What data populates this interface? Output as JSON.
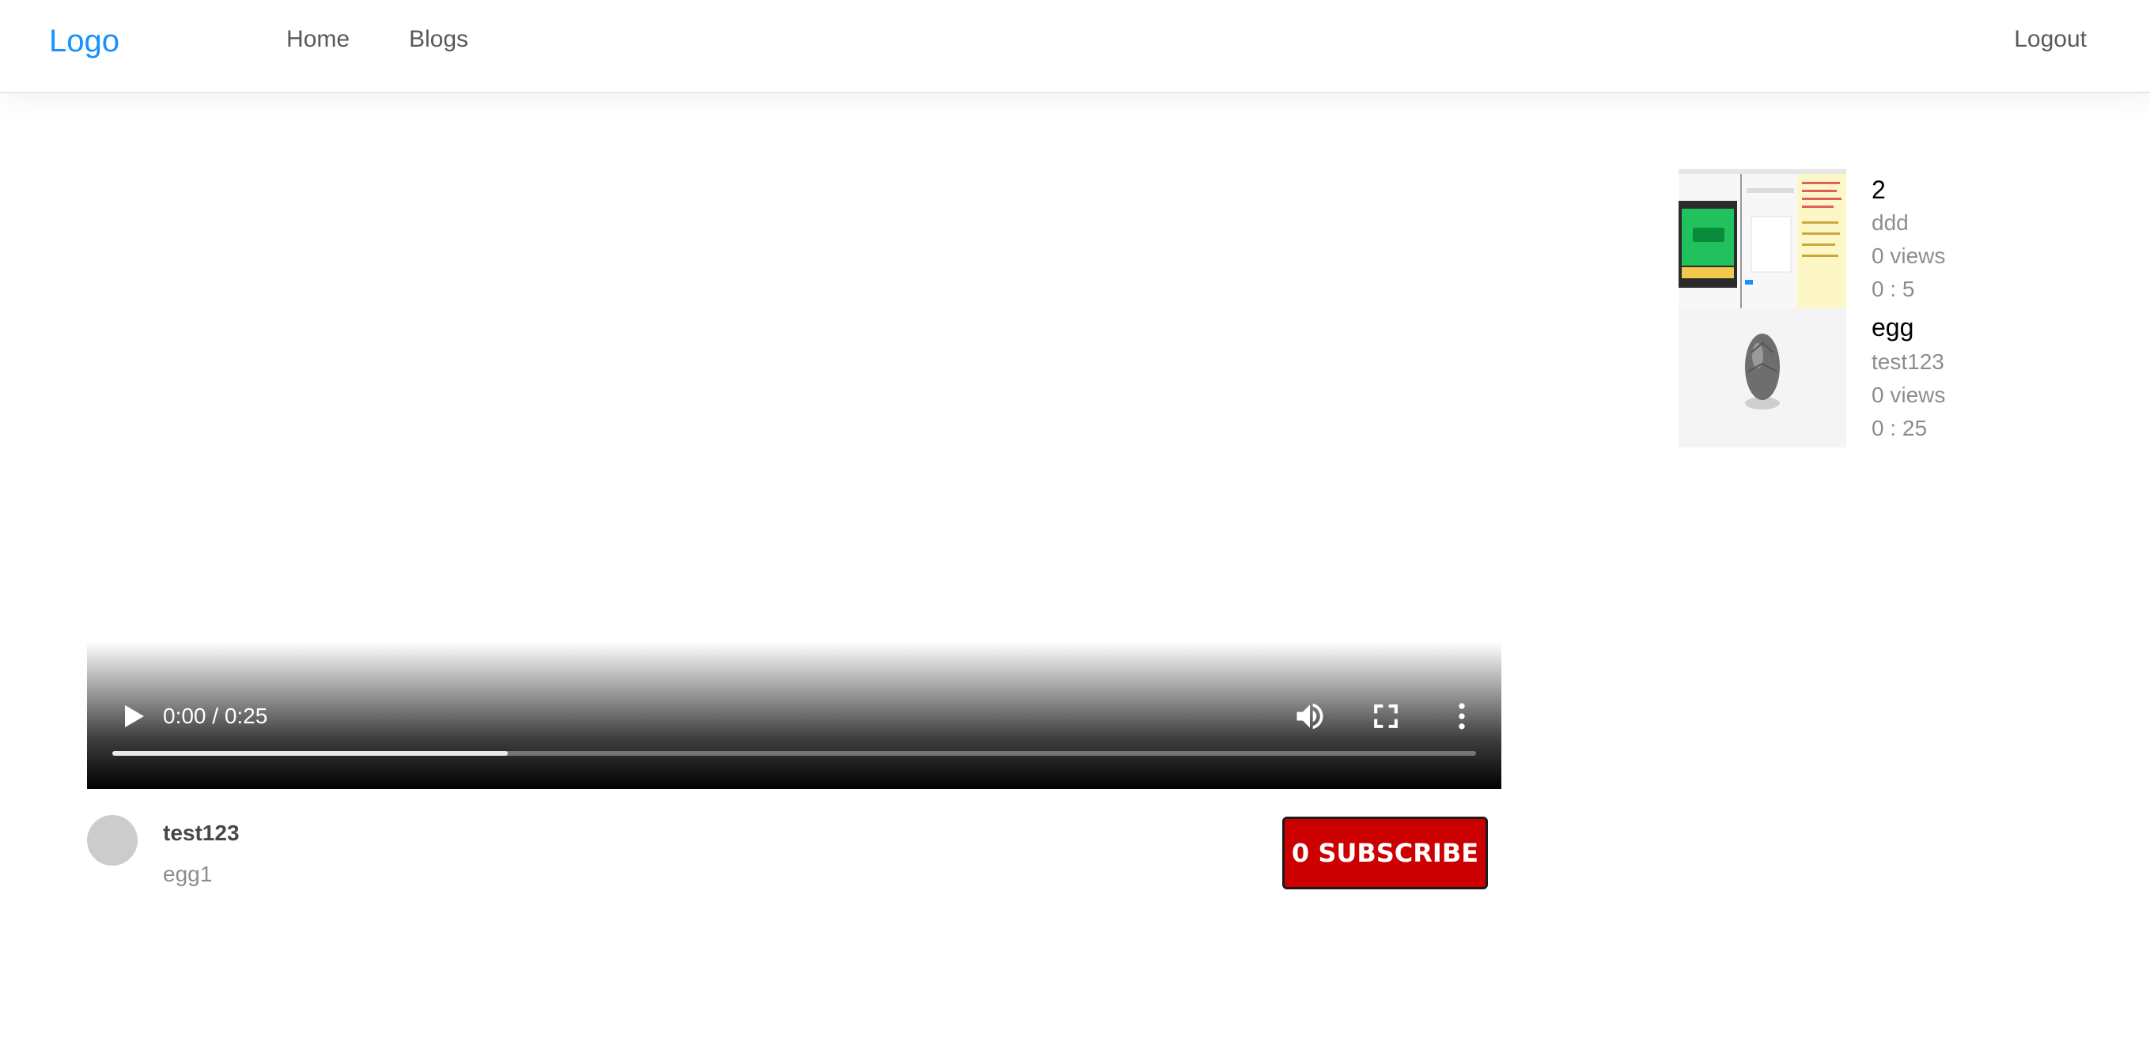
{
  "nav": {
    "logo": "Logo",
    "links": [
      "Home",
      "Blogs"
    ],
    "logout": "Logout"
  },
  "player": {
    "time": "0:00 / 0:25",
    "progress": 0.29
  },
  "channel": {
    "name": "test123",
    "description": "egg1",
    "subscribe_label": "0 SUBSCRIBE"
  },
  "sidebar": {
    "videos": [
      {
        "title": "2",
        "author": "ddd",
        "views": "0 views",
        "duration": "0 : 5"
      },
      {
        "title": "egg",
        "author": "test123",
        "views": "0 views",
        "duration": "0 : 25"
      }
    ]
  },
  "colors": {
    "logo": "#1890ff",
    "subscribe": "#cc0000"
  }
}
